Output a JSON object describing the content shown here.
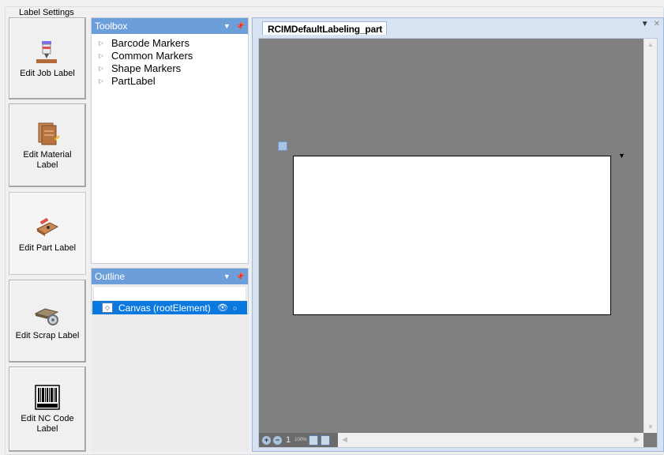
{
  "group": {
    "title": "Label Settings"
  },
  "label_buttons": [
    {
      "label": "Edit Job Label",
      "icon": "marker-pen-icon"
    },
    {
      "label": "Edit Material\nLabel",
      "icon": "material-stack-icon"
    },
    {
      "label": "Edit Part Label",
      "icon": "part-label-icon"
    },
    {
      "label": "Edit Scrap Label",
      "icon": "scrap-gear-icon"
    },
    {
      "label": "Edit NC Code\nLabel",
      "icon": "barcode-icon"
    }
  ],
  "toolbox": {
    "title": "Toolbox",
    "items": [
      "Barcode Markers",
      "Common Markers",
      "Shape Markers",
      "PartLabel"
    ]
  },
  "outline": {
    "title": "Outline",
    "row_label": "Canvas (rootElement)"
  },
  "document": {
    "tab_label": "RCIMDefaultLabeling_part",
    "zoom_value": "1",
    "zoom_percent": "100%"
  },
  "colors": {
    "panel_header": "#6c9fd9",
    "selection": "#0a79df",
    "canvas_bg": "#808080"
  }
}
